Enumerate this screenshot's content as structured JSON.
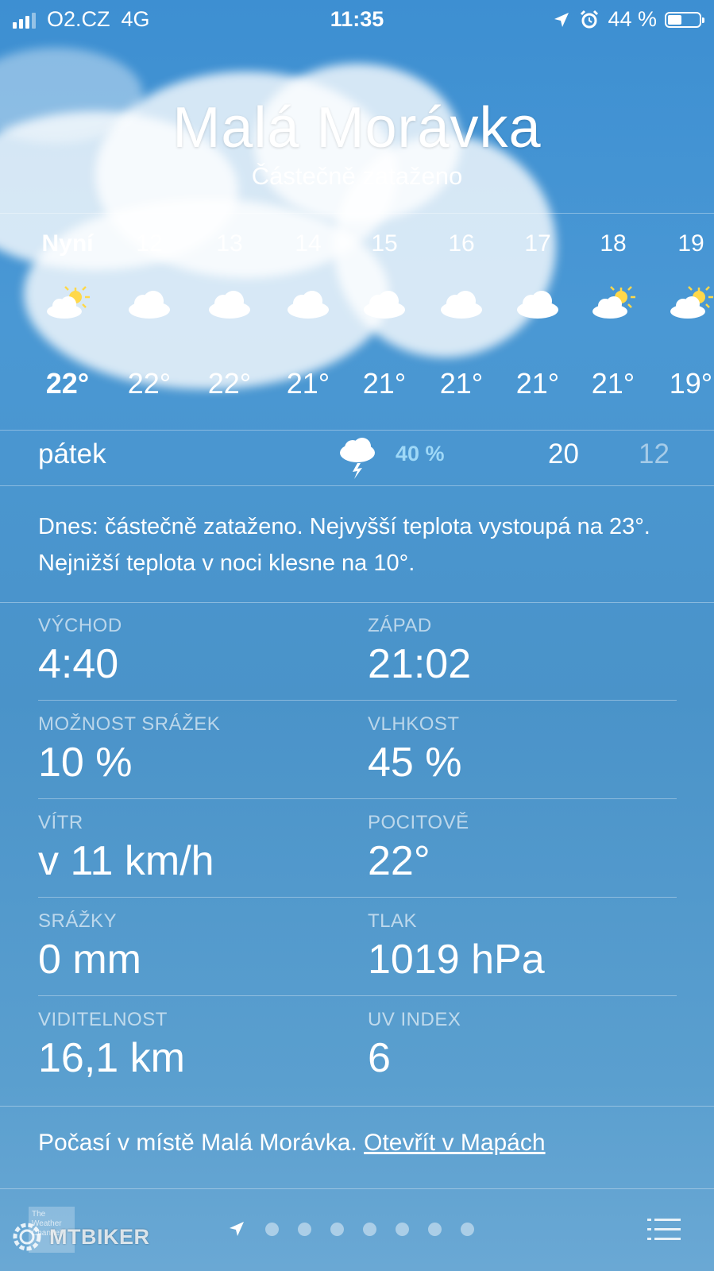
{
  "status_bar": {
    "carrier": "O2.CZ",
    "network": "4G",
    "time": "11:35",
    "battery": "44 %",
    "battery_level": 0.44,
    "icons": [
      "signal-icon",
      "location-arrow-icon",
      "alarm-icon",
      "battery-icon"
    ]
  },
  "location": {
    "city": "Malá Morávka",
    "condition": "Částečně zataženo"
  },
  "hourly": [
    {
      "label": "Nyní",
      "temp": "22°",
      "icon": "partly-sunny-icon"
    },
    {
      "label": "12",
      "temp": "22°",
      "icon": "cloud-icon"
    },
    {
      "label": "13",
      "temp": "22°",
      "icon": "cloud-icon"
    },
    {
      "label": "14",
      "temp": "21°",
      "icon": "cloud-icon"
    },
    {
      "label": "15",
      "temp": "21°",
      "icon": "cloud-icon"
    },
    {
      "label": "16",
      "temp": "21°",
      "icon": "cloud-icon"
    },
    {
      "label": "17",
      "temp": "21°",
      "icon": "cloud-icon"
    },
    {
      "label": "18",
      "temp": "21°",
      "icon": "partly-sunny-icon"
    },
    {
      "label": "19",
      "temp": "19°",
      "icon": "partly-sunny-icon"
    }
  ],
  "today": {
    "day": "pátek",
    "precip": "40 %",
    "icon": "thunderstorm-icon",
    "high": "20",
    "low": "12"
  },
  "summary": "Dnes: částečně zataženo. Nejvyšší teplota vystoupá na 23°. Nejnižší teplota v noci klesne na 10°.",
  "details": [
    {
      "left_label": "VÝCHOD",
      "left_value": "4:40",
      "right_label": "ZÁPAD",
      "right_value": "21:02"
    },
    {
      "left_label": "MOŽNOST SRÁŽEK",
      "left_value": "10 %",
      "right_label": "VLHKOST",
      "right_value": "45 %"
    },
    {
      "left_label": "VÍTR",
      "left_value": "v 11 km/h",
      "right_label": "POCITOVĚ",
      "right_value": "22°"
    },
    {
      "left_label": "SRÁŽKY",
      "left_value": "0 mm",
      "right_label": "TLAK",
      "right_value": "1019 hPa"
    },
    {
      "left_label": "VIDITELNOST",
      "left_value": "16,1 km",
      "right_label": "UV INDEX",
      "right_value": "6"
    }
  ],
  "footer": {
    "text": "Počasí v místě Malá Morávka.",
    "link": "Otevřít v Mapách"
  },
  "tab_bar": {
    "logo_text": "The Weather Channel",
    "watermark": "MTBIKER",
    "page_count": 7,
    "icons": [
      "weather-channel-logo",
      "location-arrow-icon",
      "list-icon"
    ]
  },
  "colors": {
    "precip_accent": "#9ed8f7",
    "background_top": "#3d8fd2",
    "background_bottom": "#6aa8d4"
  }
}
